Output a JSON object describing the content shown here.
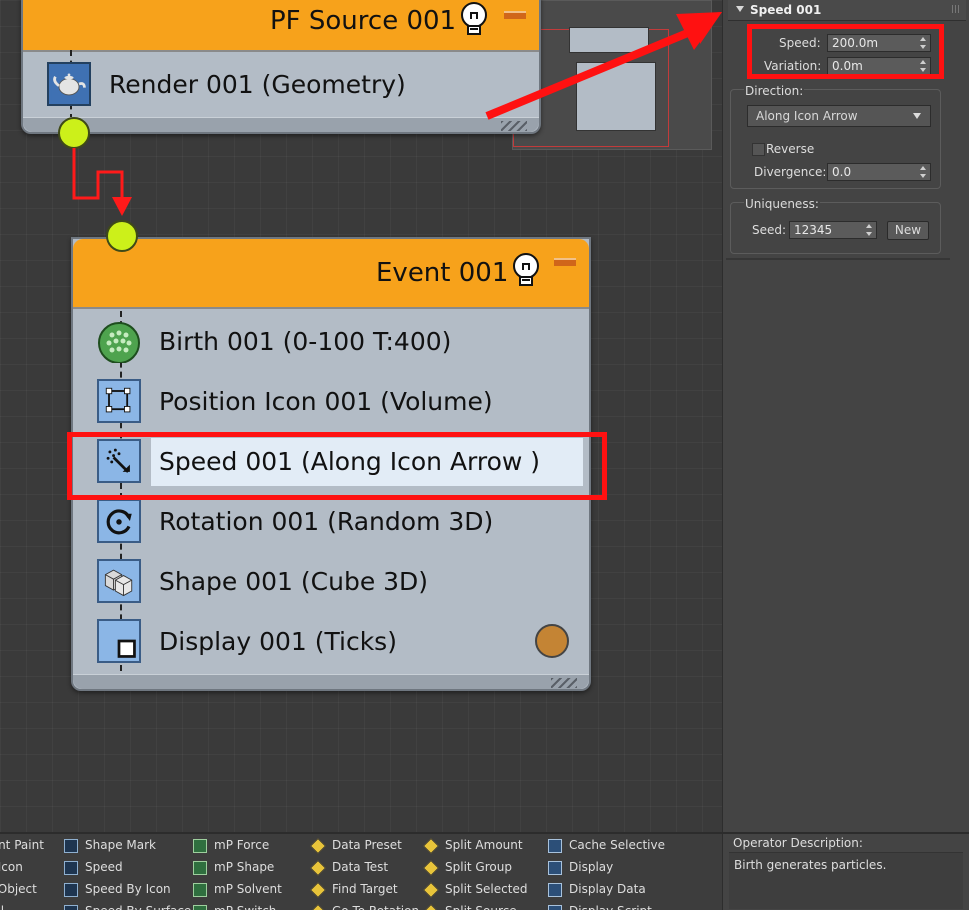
{
  "pf_source": {
    "title": "PF Source 001",
    "operators": [
      {
        "label": "Render 001 (Geometry)",
        "icon": "teapot-icon"
      }
    ]
  },
  "event": {
    "title": "Event 001",
    "operators": [
      {
        "label": "Birth 001 (0-100 T:400)",
        "icon": "birth-icon"
      },
      {
        "label": "Position Icon 001 (Volume)",
        "icon": "position-icon"
      },
      {
        "label": "Speed 001 (Along Icon Arrow )",
        "icon": "speed-icon"
      },
      {
        "label": "Rotation 001 (Random 3D)",
        "icon": "rotation-icon"
      },
      {
        "label": "Shape 001 (Cube 3D)",
        "icon": "shape-icon"
      },
      {
        "label": "Display 001 (Ticks)",
        "icon": "display-icon"
      }
    ],
    "selected_operator": "Speed 001 (Along Icon Arrow )"
  },
  "panel": {
    "rollout_title": "Speed 001",
    "speed_label": "Speed:",
    "speed_value": "200.0m",
    "variation_label": "Variation:",
    "variation_value": "0.0m",
    "direction_label": "Direction:",
    "direction_value": "Along Icon Arrow",
    "reverse_label": "Reverse",
    "reverse_checked": false,
    "divergence_label": "Divergence:",
    "divergence_value": "0.0",
    "uniqueness_label": "Uniqueness:",
    "seed_label": "Seed:",
    "seed_value": "12345",
    "new_button": "New"
  },
  "depot": {
    "columns": [
      [
        "ment Paint",
        "on Icon",
        "on Object",
        "Wall"
      ],
      [
        "Shape Mark",
        "Speed",
        "Speed By Icon",
        "Speed By Surface"
      ],
      [
        "mP Force",
        "mP Shape",
        "mP Solvent",
        "mP Switch"
      ],
      [
        "Data Preset",
        "Data Test",
        "Find Target",
        "Go To Rotation"
      ],
      [
        "Split Amount",
        "Split Group",
        "Split Selected",
        "Split Source"
      ],
      [
        "Cache Selective",
        "Display",
        "Display Data",
        "Display Script"
      ]
    ]
  },
  "description": {
    "label": "Operator Description:",
    "text": "Birth generates particles."
  },
  "colors": {
    "node_header": "#f7a21b",
    "socket": "#ccf01a",
    "wire": "#ff1a1a",
    "highlight": "#ff1111"
  }
}
